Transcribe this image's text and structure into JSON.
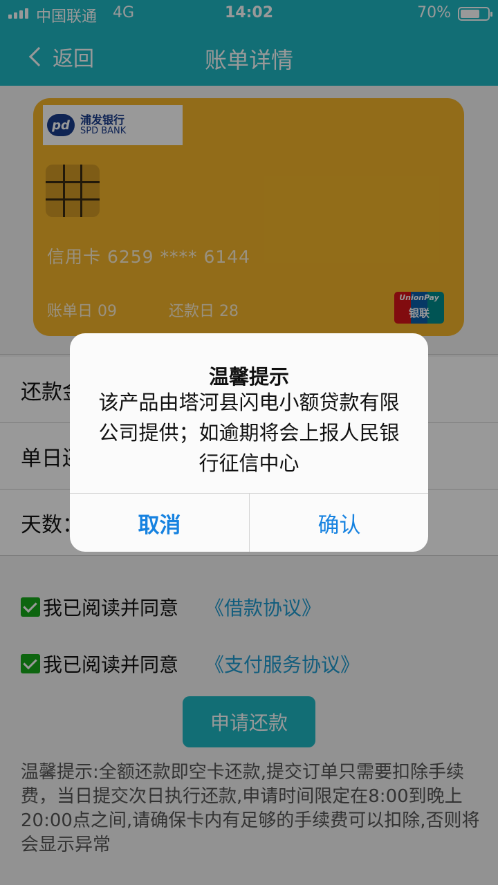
{
  "status": {
    "carrier": "中国联通",
    "network": "4G",
    "time": "14:02",
    "battery": "70%",
    "battery_level": 0.7
  },
  "nav": {
    "back_label": "返回",
    "title": "账单详情"
  },
  "card": {
    "bank_name_cn": "浦发银行",
    "bank_name_en": "SPD BANK",
    "number": "信用卡 6259 **** 6144",
    "bill_day": "账单日 09",
    "pay_day": "还款日 28",
    "network_en": "UnionPay",
    "network_cn": "银联",
    "color": "#f4b52a"
  },
  "form": {
    "rows": [
      {
        "label": "还款金额："
      },
      {
        "label": "单日还款："
      },
      {
        "label": "天数："
      }
    ]
  },
  "agreements": [
    {
      "text": "我已阅读并同意",
      "link": "《借款协议》",
      "checked": true
    },
    {
      "text": "我已阅读并同意",
      "link": "《支付服务协议》",
      "checked": true
    }
  ],
  "apply_button": "申请还款",
  "notice": "温馨提示:全额还款即空卡还款,提交订单只需要扣除手续费，当日提交次日执行还款,申请时间限定在8:00到晚上20:00点之间,请确保卡内有足够的手续费可以扣除,否则将会显示异常",
  "dialog": {
    "title": "温馨提示",
    "message": "该产品由塔河县闪电小额贷款有限公司提供；如逾期将会上报人民银行征信中心",
    "cancel": "取消",
    "confirm": "确认"
  },
  "colors": {
    "primary": "#1fb7c4",
    "link": "#1f9bd1",
    "dialog_button": "#1682e0"
  }
}
